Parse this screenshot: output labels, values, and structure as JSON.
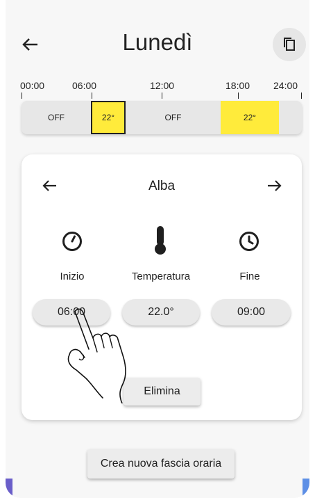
{
  "header": {
    "title": "Lunedì",
    "back_icon": "arrow-left-icon",
    "copy_icon": "copy-icon"
  },
  "timeline": {
    "ticks": [
      "00:00",
      "06:00",
      "12:00",
      "18:00",
      "24:00"
    ],
    "segments": [
      {
        "label": "OFF",
        "color": "#e7e7e7"
      },
      {
        "label": "22°",
        "color": "#ffeb3b",
        "selected": true
      },
      {
        "label": "OFF",
        "color": "#e7e7e7"
      },
      {
        "label": "22°",
        "color": "#ffeb3b"
      }
    ]
  },
  "card": {
    "title": "Alba",
    "prev_icon": "arrow-left-icon",
    "next_icon": "arrow-right-icon",
    "start": {
      "icon": "timer-icon",
      "label": "Inizio",
      "value": "06:00"
    },
    "temperature": {
      "icon": "thermometer-icon",
      "label": "Temperatura",
      "value": "22.0°"
    },
    "end": {
      "icon": "clock-icon",
      "label": "Fine",
      "value": "09:00"
    },
    "delete_label": "Elimina"
  },
  "footer": {
    "create_label": "Crea nuova fascia oraria"
  },
  "colors": {
    "accent_yellow": "#ffeb3b",
    "background": "#f7f7f7",
    "card": "#ffffff"
  }
}
